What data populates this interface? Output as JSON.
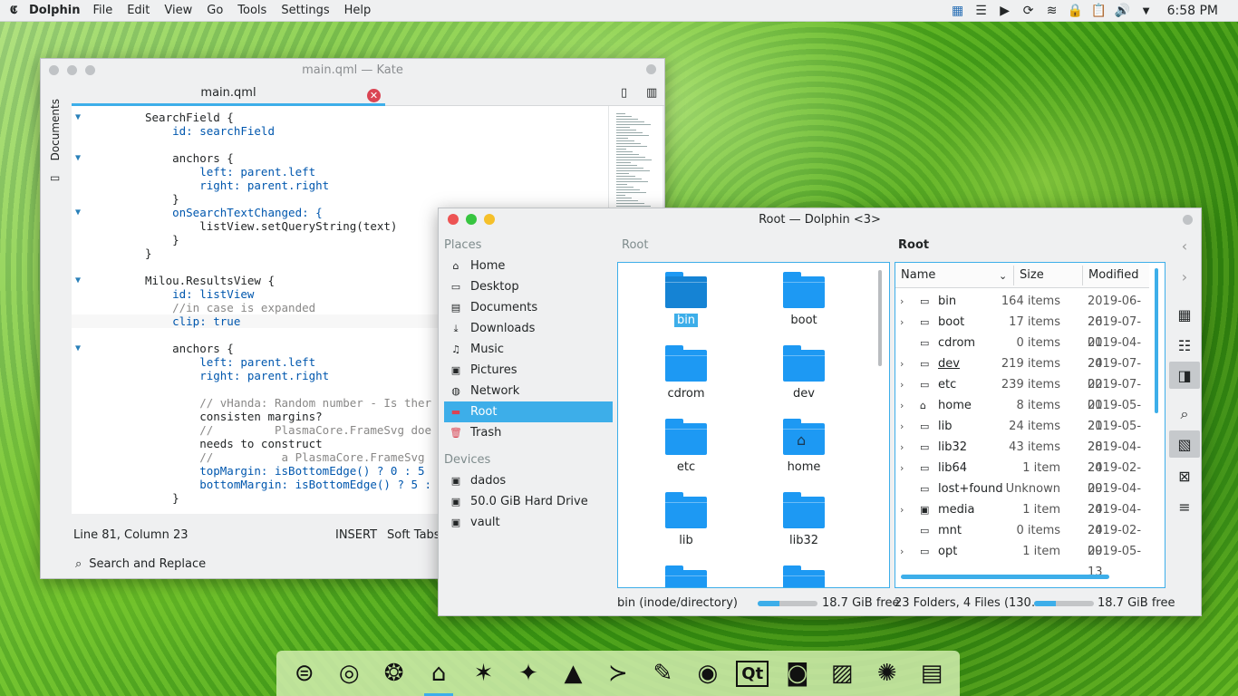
{
  "topbar": {
    "app_logo": "𝕮",
    "app_name": "Dolphin",
    "menu": [
      "File",
      "Edit",
      "View",
      "Go",
      "Tools",
      "Settings",
      "Help"
    ],
    "tray_icons": [
      "task-manager-icon",
      "notes-icon",
      "media-play-icon",
      "update-icon",
      "network-icon",
      "lock-icon",
      "clipboard-icon",
      "volume-icon",
      "expand-arrow-icon"
    ],
    "tray_glyphs": [
      "▦",
      "☰",
      "▶",
      "⟳",
      "≋",
      "🔒",
      "📋",
      "🔊",
      "▼"
    ],
    "clock": "6:58 PM"
  },
  "kate": {
    "title": "main.qml — Kate",
    "side_label": "Documents",
    "tab_label": "main.qml",
    "tab_close": "✕",
    "status": {
      "position": "Line 81, Column 23",
      "mode": "INSERT",
      "tabs": "Soft Tabs:"
    },
    "search": "Search and Replace",
    "lines": [
      {
        "fold": true,
        "text": "SearchField {"
      },
      {
        "fold": false,
        "text": "    id: searchField"
      },
      {
        "fold": false,
        "text": ""
      },
      {
        "fold": true,
        "text": "    anchors {"
      },
      {
        "fold": false,
        "text": "        left: parent.left"
      },
      {
        "fold": false,
        "text": "        right: parent.right"
      },
      {
        "fold": false,
        "text": "    }"
      },
      {
        "fold": true,
        "text": "    onSearchTextChanged: {"
      },
      {
        "fold": false,
        "text": "        listView.setQueryString(text)"
      },
      {
        "fold": false,
        "text": "    }"
      },
      {
        "fold": false,
        "text": "}"
      },
      {
        "fold": false,
        "text": ""
      },
      {
        "fold": true,
        "text": "Milou.ResultsView {"
      },
      {
        "fold": false,
        "text": "    id: listView"
      },
      {
        "fold": false,
        "text": "    //in case is expanded"
      },
      {
        "fold": false,
        "text": "    clip: true"
      },
      {
        "fold": false,
        "text": ""
      },
      {
        "fold": true,
        "text": "    anchors {"
      },
      {
        "fold": false,
        "text": "        left: parent.left"
      },
      {
        "fold": false,
        "text": "        right: parent.right"
      },
      {
        "fold": false,
        "text": ""
      },
      {
        "fold": false,
        "text": "        // vHanda: Random number - Is ther"
      },
      {
        "fold": false,
        "text": "        consisten margins?"
      },
      {
        "fold": false,
        "text": "        //         PlasmaCore.FrameSvg doe"
      },
      {
        "fold": false,
        "text": "        needs to construct"
      },
      {
        "fold": false,
        "text": "        //          a PlasmaCore.FrameSvg"
      },
      {
        "fold": false,
        "text": "        topMargin: isBottomEdge() ? 0 : 5"
      },
      {
        "fold": false,
        "text": "        bottomMargin: isBottomEdge() ? 5 :"
      },
      {
        "fold": false,
        "text": "    }"
      }
    ]
  },
  "dolphin": {
    "title": "Root — Dolphin <3>",
    "places_header": "Places",
    "places": [
      {
        "label": "Home",
        "icon": "home-icon",
        "glyph": "⌂"
      },
      {
        "label": "Desktop",
        "icon": "folder-icon",
        "glyph": "▭"
      },
      {
        "label": "Documents",
        "icon": "document-icon",
        "glyph": "▤"
      },
      {
        "label": "Downloads",
        "icon": "download-icon",
        "glyph": "⤓"
      },
      {
        "label": "Music",
        "icon": "music-icon",
        "glyph": "♫"
      },
      {
        "label": "Pictures",
        "icon": "picture-icon",
        "glyph": "▣"
      },
      {
        "label": "Network",
        "icon": "network-icon",
        "glyph": "◍"
      },
      {
        "label": "Root",
        "icon": "root-icon",
        "glyph": "▬"
      },
      {
        "label": "Trash",
        "icon": "trash-icon",
        "glyph": "🗑"
      }
    ],
    "devices_header": "Devices",
    "devices": [
      {
        "label": "dados",
        "icon": "drive-icon",
        "glyph": "▣"
      },
      {
        "label": "50.0 GiB Hard Drive",
        "icon": "harddrive-icon",
        "glyph": "▣"
      },
      {
        "label": "vault",
        "icon": "vault-icon",
        "glyph": "▣"
      }
    ],
    "left_crumb": "Root",
    "right_crumb": "Root",
    "icon_items": [
      "bin",
      "boot",
      "cdrom",
      "dev",
      "etc",
      "home",
      "lib",
      "lib32",
      "",
      ""
    ],
    "columns": {
      "name": "Name",
      "size": "Size",
      "modified": "Modified"
    },
    "rows": [
      {
        "exp": true,
        "name": "bin",
        "size": "164 items",
        "modified": "2019-06-26"
      },
      {
        "exp": true,
        "name": "boot",
        "size": "17 items",
        "modified": "2019-07-01"
      },
      {
        "exp": false,
        "name": "cdrom",
        "size": "0 items",
        "modified": "2019-04-24"
      },
      {
        "exp": true,
        "name": "dev",
        "size": "219 items",
        "modified": "2019-07-02"
      },
      {
        "exp": true,
        "name": "etc",
        "size": "239 items",
        "modified": "2019-07-01"
      },
      {
        "exp": true,
        "name": "home",
        "size": "8 items",
        "modified": "2019-05-21"
      },
      {
        "exp": true,
        "name": "lib",
        "size": "24 items",
        "modified": "2019-05-28"
      },
      {
        "exp": true,
        "name": "lib32",
        "size": "43 items",
        "modified": "2019-04-24"
      },
      {
        "exp": true,
        "name": "lib64",
        "size": "1 item",
        "modified": "2019-02-09"
      },
      {
        "exp": false,
        "name": "lost+found",
        "size": "Unknown",
        "modified": "2019-04-24"
      },
      {
        "exp": true,
        "name": "media",
        "size": "1 item",
        "modified": "2019-04-24"
      },
      {
        "exp": false,
        "name": "mnt",
        "size": "0 items",
        "modified": "2019-02-09"
      },
      {
        "exp": true,
        "name": "opt",
        "size": "1 item",
        "modified": "2019-05-13"
      }
    ],
    "status_left": "bin (inode/directory)",
    "free_left": "18.7 GiB free",
    "status_right": "23 Folders, 4 Files (130…",
    "free_right": "18.7 GiB free",
    "disk_usage_fraction": 0.36,
    "accent": "#3daee9"
  },
  "dock": {
    "icons": [
      "settings-toggle-icon",
      "chromium-icon",
      "firefox-icon",
      "dolphin-icon",
      "gimp-icon",
      "inkscape-icon",
      "vlc-icon",
      "terminal-icon",
      "kate-icon",
      "eye-icon",
      "qt-creator-icon",
      "camera-icon",
      "document-viewer-icon",
      "fan-icon",
      "text-editor-icon"
    ],
    "glyphs": [
      "⊜",
      "◎",
      "❂",
      "⌂",
      "✶",
      "✦",
      "▲",
      "≻",
      "✎",
      "◉",
      "Qt",
      "◙",
      "▨",
      "✺",
      "▤"
    ]
  }
}
